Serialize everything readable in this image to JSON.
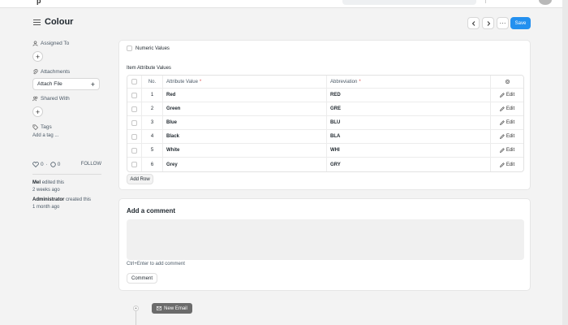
{
  "topbar": {
    "logo_text": "p"
  },
  "header": {
    "title": "Colour",
    "prev_icon": "chevron-left-icon",
    "next_icon": "chevron-right-icon",
    "more_label": "···",
    "save_label": "Save"
  },
  "sidebar": {
    "assigned_to_label": "Assigned To",
    "attachments_label": "Attachments",
    "attach_file_label": "Attach File",
    "shared_with_label": "Shared With",
    "tags_label": "Tags",
    "add_tag_label": "Add a tag ...",
    "likes_count": "0",
    "comments_count": "0",
    "follow_label": "FOLLOW",
    "activity": [
      {
        "user": "Mel",
        "action": "edited this",
        "when": "2 weeks ago"
      },
      {
        "user": "Administrator",
        "action": "created this",
        "when": "1 month ago"
      }
    ]
  },
  "form": {
    "numeric_values_label": "Numeric Values",
    "table_label": "Item Attribute Values",
    "columns": {
      "no": "No.",
      "attribute_value": "Attribute Value",
      "abbreviation": "Abbreviation"
    },
    "rows": [
      {
        "no": "1",
        "value": "Red",
        "abbr": "RED",
        "edit": "Edit"
      },
      {
        "no": "2",
        "value": "Green",
        "abbr": "GRE",
        "edit": "Edit"
      },
      {
        "no": "3",
        "value": "Blue",
        "abbr": "BLU",
        "edit": "Edit"
      },
      {
        "no": "4",
        "value": "Black",
        "abbr": "BLA",
        "edit": "Edit"
      },
      {
        "no": "5",
        "value": "White",
        "abbr": "WHI",
        "edit": "Edit"
      },
      {
        "no": "6",
        "value": "Grey",
        "abbr": "GRY",
        "edit": "Edit"
      }
    ],
    "add_row_label": "Add Row"
  },
  "comments": {
    "title": "Add a comment",
    "hint": "Ctrl+Enter to add comment",
    "button_label": "Comment"
  },
  "timeline": {
    "new_email_label": "New Email"
  },
  "colors": {
    "accent": "#2490ef",
    "required": "#e24c4c"
  }
}
